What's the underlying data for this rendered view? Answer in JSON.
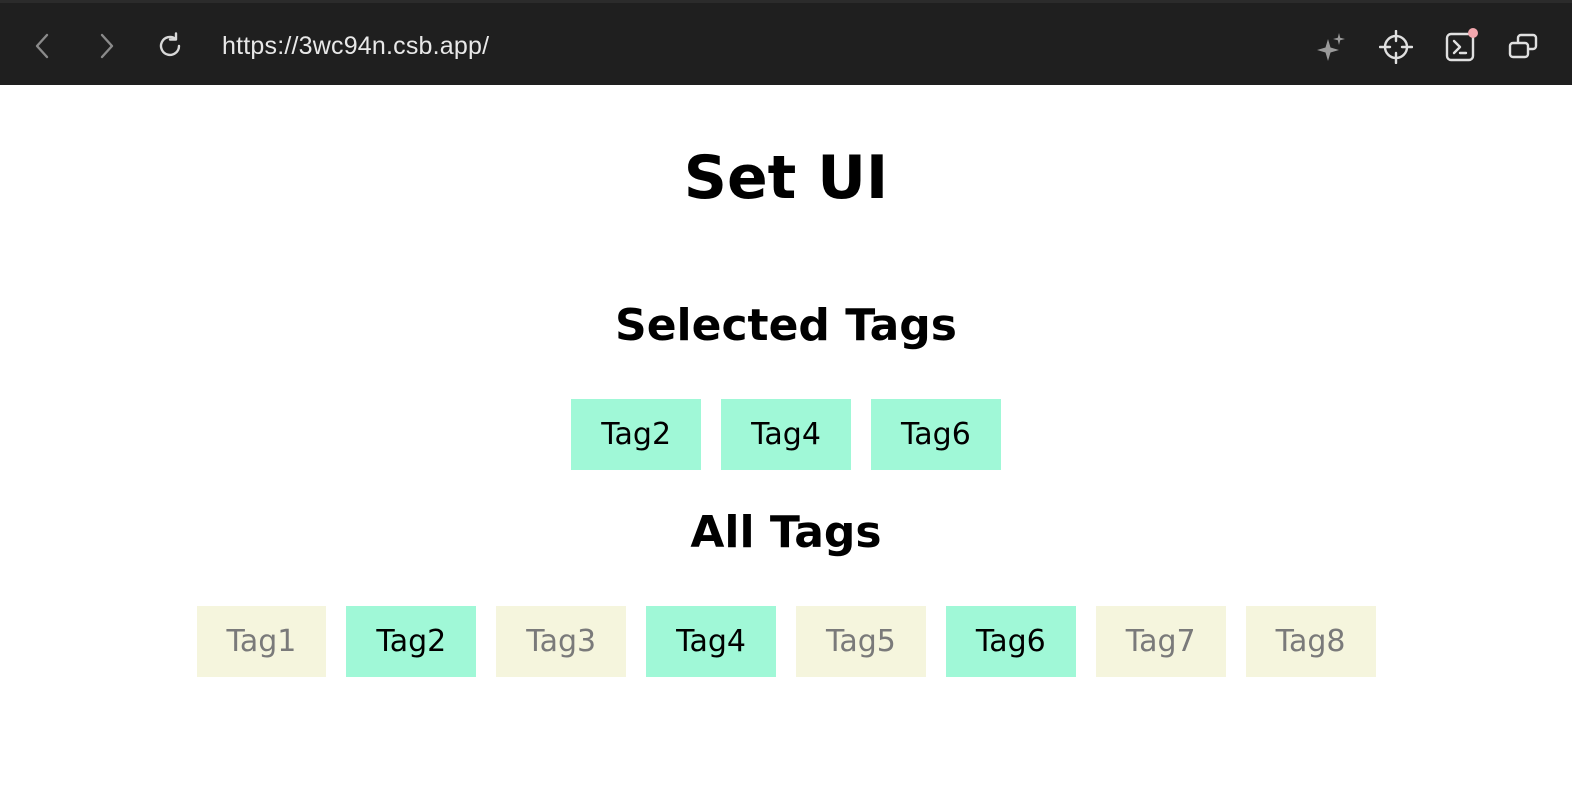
{
  "browser": {
    "url": "https://3wc94n.csb.app/",
    "icons": {
      "back": "chevron-left-icon",
      "forward": "chevron-right-icon",
      "reload": "reload-icon",
      "ai": "sparkle-icon",
      "inspect": "crosshair-icon",
      "terminal": "terminal-icon",
      "windows": "windows-icon"
    },
    "colors": {
      "bar_bg": "#1f1f1f",
      "icon": "#cfcfcf",
      "notification": "#f2a7ae"
    }
  },
  "app": {
    "title": "Set UI",
    "selected_heading": "Selected Tags",
    "all_heading": "All Tags",
    "selected_tags": [
      "Tag2",
      "Tag4",
      "Tag6"
    ],
    "all_tags": [
      {
        "label": "Tag1",
        "selected": false
      },
      {
        "label": "Tag2",
        "selected": true
      },
      {
        "label": "Tag3",
        "selected": false
      },
      {
        "label": "Tag4",
        "selected": true
      },
      {
        "label": "Tag5",
        "selected": false
      },
      {
        "label": "Tag6",
        "selected": true
      },
      {
        "label": "Tag7",
        "selected": false
      },
      {
        "label": "Tag8",
        "selected": false
      }
    ],
    "colors": {
      "selected_bg": "#a0f8d7",
      "unselected_bg": "#f5f5dd",
      "unselected_text": "#7a7a7a"
    }
  }
}
